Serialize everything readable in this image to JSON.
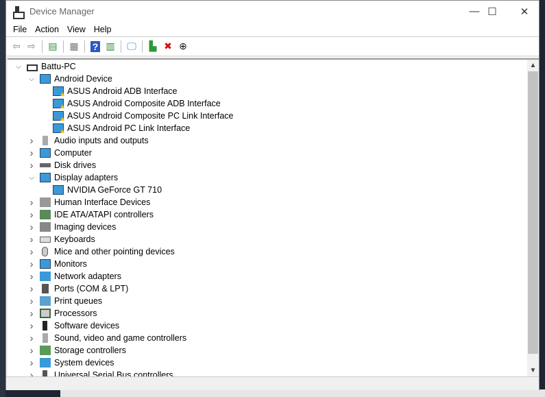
{
  "window": {
    "title": "Device Manager"
  },
  "menu": [
    "File",
    "Action",
    "View",
    "Help"
  ],
  "toolbar": [
    {
      "name": "back-icon",
      "glyph": "⇦",
      "color": "#888"
    },
    {
      "name": "forward-icon",
      "glyph": "⇨",
      "color": "#888"
    },
    {
      "sep": true
    },
    {
      "name": "show-hide-console-tree-icon",
      "glyph": "▤",
      "color": "#3a8a3a"
    },
    {
      "sep": true
    },
    {
      "name": "properties-icon",
      "glyph": "▦",
      "color": "#777"
    },
    {
      "sep": true
    },
    {
      "name": "help-icon",
      "glyph": "?",
      "color": "#fff",
      "bg": "#2b58c4"
    },
    {
      "name": "show-action-pane-icon",
      "glyph": "▥",
      "color": "#3a8a3a"
    },
    {
      "sep": true
    },
    {
      "name": "scan-hardware-icon",
      "glyph": "🖵",
      "color": "#2a8ad4"
    },
    {
      "sep": true
    },
    {
      "name": "update-driver-icon",
      "glyph": "▙",
      "color": "#2a9a3a"
    },
    {
      "name": "uninstall-device-icon",
      "glyph": "✖",
      "color": "#d01010"
    },
    {
      "name": "download-icon",
      "glyph": "⊕",
      "color": "#111"
    }
  ],
  "tree": [
    {
      "label": "Battu-PC",
      "level": 0,
      "state": "expanded",
      "icon": "computer-root"
    },
    {
      "label": "Android Device",
      "level": 1,
      "state": "expanded",
      "icon": "monitor"
    },
    {
      "label": "ASUS Android ADB Interface",
      "level": 2,
      "icon": "warning-device"
    },
    {
      "label": "ASUS Android Composite ADB Interface",
      "level": 2,
      "icon": "warning-device"
    },
    {
      "label": "ASUS Android Composite PC Link Interface",
      "level": 2,
      "icon": "warning-device"
    },
    {
      "label": "ASUS Android PC Link Interface",
      "level": 2,
      "icon": "warning-device"
    },
    {
      "label": "Audio inputs and outputs",
      "level": 1,
      "state": "collapsed",
      "icon": "speaker"
    },
    {
      "label": "Computer",
      "level": 1,
      "state": "collapsed",
      "icon": "monitor"
    },
    {
      "label": "Disk drives",
      "level": 1,
      "state": "collapsed",
      "icon": "disk"
    },
    {
      "label": "Display adapters",
      "level": 1,
      "state": "expanded",
      "icon": "monitor"
    },
    {
      "label": "NVIDIA GeForce GT 710",
      "level": 2,
      "icon": "monitor"
    },
    {
      "label": "Human Interface Devices",
      "level": 1,
      "state": "collapsed",
      "icon": "hid"
    },
    {
      "label": "IDE ATA/ATAPI controllers",
      "level": 1,
      "state": "collapsed",
      "icon": "controller"
    },
    {
      "label": "Imaging devices",
      "level": 1,
      "state": "collapsed",
      "icon": "camera"
    },
    {
      "label": "Keyboards",
      "level": 1,
      "state": "collapsed",
      "icon": "keyboard"
    },
    {
      "label": "Mice and other pointing devices",
      "level": 1,
      "state": "collapsed",
      "icon": "mouse"
    },
    {
      "label": "Monitors",
      "level": 1,
      "state": "collapsed",
      "icon": "monitor"
    },
    {
      "label": "Network adapters",
      "level": 1,
      "state": "collapsed",
      "icon": "network"
    },
    {
      "label": "Ports (COM & LPT)",
      "level": 1,
      "state": "collapsed",
      "icon": "port"
    },
    {
      "label": "Print queues",
      "level": 1,
      "state": "collapsed",
      "icon": "printer"
    },
    {
      "label": "Processors",
      "level": 1,
      "state": "collapsed",
      "icon": "processor"
    },
    {
      "label": "Software devices",
      "level": 1,
      "state": "collapsed",
      "icon": "software"
    },
    {
      "label": "Sound, video and game controllers",
      "level": 1,
      "state": "collapsed",
      "icon": "speaker"
    },
    {
      "label": "Storage controllers",
      "level": 1,
      "state": "collapsed",
      "icon": "storage"
    },
    {
      "label": "System devices",
      "level": 1,
      "state": "collapsed",
      "icon": "system"
    },
    {
      "label": "Universal Serial Bus controllers",
      "level": 1,
      "state": "collapsed",
      "icon": "usb"
    }
  ],
  "colors": {
    "warning": "#f4c20d",
    "monitor": "#3a9ad9"
  }
}
